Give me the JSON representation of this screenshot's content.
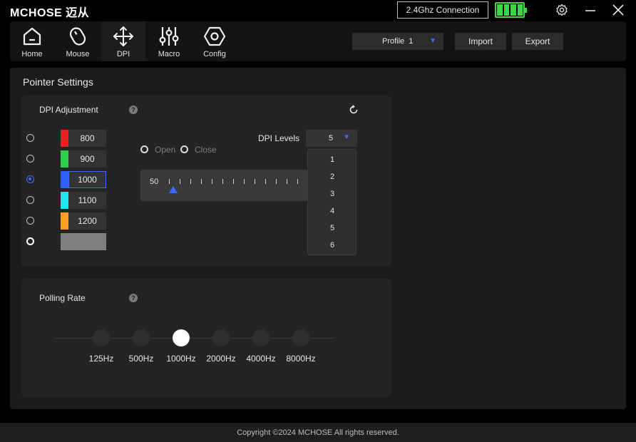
{
  "app": {
    "brand": "MCHOSE 迈从",
    "connection": "2.4Ghz Connection",
    "battery_cells": 4
  },
  "nav": {
    "items": [
      {
        "label": "Home",
        "icon": "home-icon"
      },
      {
        "label": "Mouse",
        "icon": "mouse-icon"
      },
      {
        "label": "DPI",
        "icon": "move-arrows-icon"
      },
      {
        "label": "Macro",
        "icon": "sliders-icon"
      },
      {
        "label": "Config",
        "icon": "hexagon-icon"
      }
    ],
    "active": "DPI"
  },
  "toolbar": {
    "profile": "Profile  1",
    "import": "Import",
    "export": "Export"
  },
  "page": {
    "title": "Pointer Settings"
  },
  "dpi": {
    "title": "DPI Adjustment",
    "help": "?",
    "rows": [
      {
        "value": "800",
        "color": "#e8201f"
      },
      {
        "value": "900",
        "color": "#2ed14a"
      },
      {
        "value": "1000",
        "color": "#2b62ff"
      },
      {
        "value": "1100",
        "color": "#1fe7f2"
      },
      {
        "value": "1200",
        "color": "#ff9f1f"
      },
      {
        "value": "",
        "color": "#7f7f7f"
      }
    ],
    "selected_index": 2,
    "open_label": "Open",
    "close_label": "Close",
    "slider_min": "50",
    "levels_label": "DPI Levels",
    "levels_value": "5",
    "levels_options": [
      "1",
      "2",
      "3",
      "4",
      "5",
      "6"
    ]
  },
  "polling": {
    "title": "Polling Rate",
    "help": "?",
    "rates": [
      "125Hz",
      "500Hz",
      "1000Hz",
      "2000Hz",
      "4000Hz",
      "8000Hz"
    ],
    "selected": "1000Hz"
  },
  "footer": {
    "copyright": "Copyright ©2024 MCHOSE All rights reserved."
  },
  "colors": {
    "accent": "#3c6cff",
    "battery": "#3fd641"
  }
}
